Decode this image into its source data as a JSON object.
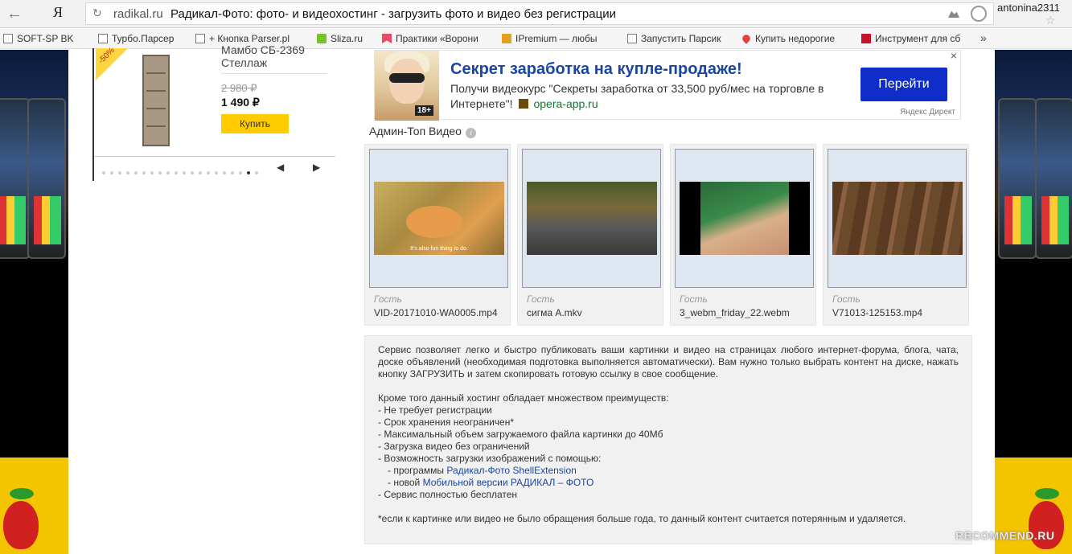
{
  "browser": {
    "yandex_logo": "Я",
    "domain": "radikal.ru",
    "title": "Радикал-Фото: фото- и видеохостинг - загрузить фото и видео без регистрации",
    "user": "antonina2311"
  },
  "bookmarks": [
    {
      "label": "SOFT-SP BK",
      "icon": "page-icon"
    },
    {
      "label": "Турбо.Парсер",
      "icon": "page-icon"
    },
    {
      "label": "+ Кнопка Parser.pl",
      "icon": "page-icon"
    },
    {
      "label": "Sliza.ru",
      "icon": "sliza-icon",
      "color": "#7cbf2a"
    },
    {
      "label": "Практики «Ворони",
      "icon": "bookmark-icon",
      "color": "#e84b6a"
    },
    {
      "label": "IPremium — любы",
      "icon": "box-icon",
      "color": "#e0a020"
    },
    {
      "label": "Запустить Парсик",
      "icon": "page-icon"
    },
    {
      "label": "Купить недорогие",
      "icon": "heart-icon",
      "color": "#e04040"
    },
    {
      "label": "Инструмент для сб",
      "icon": "vi-icon",
      "color": "#c8102e"
    }
  ],
  "product": {
    "discount": "-50%",
    "name": "Мамбо СБ-2369 Стеллаж",
    "old_price": "2 980 ₽",
    "price": "1 490 ₽",
    "buy_label": "Купить"
  },
  "ad": {
    "badge": "18+",
    "title": "Секрет заработка на купле-продаже!",
    "text": "Получи видеокурс \"Секреты заработка от 33,500 руб/мес на торговле в Интернете\"!",
    "site": "opera-app.ru",
    "button": "Перейти",
    "source": "Яндекс Директ",
    "close": "×"
  },
  "videos_section": {
    "title": "Админ-Топ Видео",
    "info": "i",
    "items": [
      {
        "user": "Гость",
        "filename": "VID-20171010-WA0005.mp4",
        "subtitle": "It's also fun thing to do."
      },
      {
        "user": "Гость",
        "filename": "сигма A.mkv"
      },
      {
        "user": "Гость",
        "filename": "3_webm_friday_22.webm"
      },
      {
        "user": "Гость",
        "filename": "V71013-125153.mp4"
      }
    ]
  },
  "description": {
    "intro": "Сервис позволяет легко и быстро публиковать ваши картинки и видео на страницах любого интернет-форума, блога, чата, доске объявлений (необходимая подготовка выполняется автоматически). Вам нужно только выбрать контент на диске, нажать кнопку ЗАГРУЗИТЬ и затем скопировать готовую ссылку в свое сообщение.",
    "advantages_title": "Кроме того данный хостинг обладает множеством преимуществ:",
    "adv1": "- Не требует регистрации",
    "adv2": "- Срок хранения неограничен*",
    "adv3": "- Максимальный объем загружаемого файла картинки до 40Мб",
    "adv4": "- Загрузка видео без ограничений",
    "adv5": "- Возможность загрузки изображений с помощью:",
    "sub1_prefix": "- программы ",
    "sub1_link": "Радикал-Фото ShellExtension",
    "sub2_prefix": "- новой ",
    "sub2_link": "Мобильной версии РАДИКАЛ – ФОТО",
    "adv6": "- Сервис полностью бесплатен",
    "footnote": "*если к картинке или видео не было обращения больше года, то данный контент считается потерянным и удаляется."
  },
  "watermark": "RECOMMEND.RU"
}
